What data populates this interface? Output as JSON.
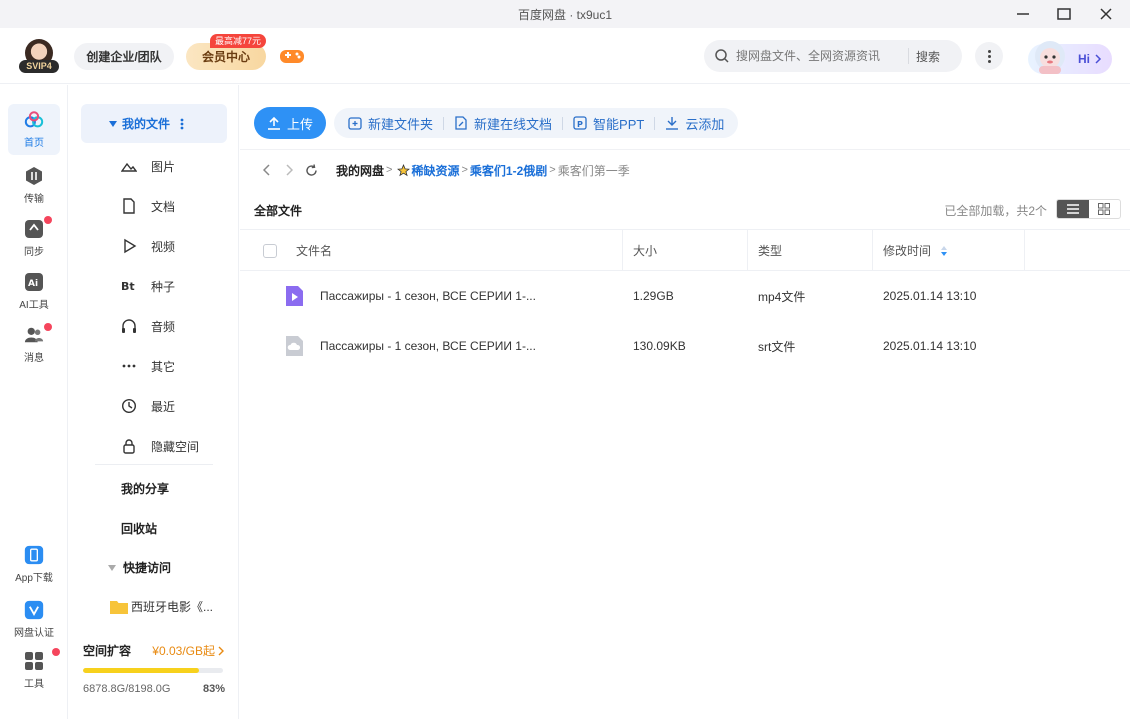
{
  "window": {
    "title": "百度网盘 · tx9uc1"
  },
  "header": {
    "vip_level": "SVIP4",
    "create_team": "创建企业/团队",
    "vip_center": "会员中心",
    "vip_badge": "最高减77元",
    "search_placeholder": "搜网盘文件、全网资源资讯",
    "search_button": "搜索",
    "hi": "Hi"
  },
  "rail": {
    "items": [
      {
        "label": "首页",
        "icon": "home-icon"
      },
      {
        "label": "传输",
        "icon": "transfer-icon"
      },
      {
        "label": "同步",
        "icon": "sync-icon"
      },
      {
        "label": "AI工具",
        "icon": "ai-icon"
      },
      {
        "label": "消息",
        "icon": "message-icon"
      }
    ],
    "bottom": [
      {
        "label": "App下载",
        "icon": "phone-icon"
      },
      {
        "label": "网盘认证",
        "icon": "verify-icon"
      },
      {
        "label": "工具",
        "icon": "grid-icon"
      }
    ]
  },
  "sidenav": {
    "my_files": "我的文件",
    "items": [
      "图片",
      "文档",
      "视频",
      "种子",
      "音频",
      "其它",
      "最近",
      "隐藏空间"
    ],
    "my_share": "我的分享",
    "recycle": "回收站",
    "quick_access": "快捷访问",
    "quick_folder": "西班牙电影《...",
    "storage": {
      "title": "空间扩容",
      "promo": "¥0.03/GB起",
      "used": "6878.8G/8198.0G",
      "percent": "83%",
      "fill": 0.83
    }
  },
  "toolbar": {
    "upload": "上传",
    "new_folder": "新建文件夹",
    "new_doc": "新建在线文档",
    "smart_ppt": "智能PPT",
    "cloud_add": "云添加"
  },
  "breadcrumb": {
    "root": "我的网盘",
    "c1": "稀缺资源",
    "c2": "乘客们1-2俄剧",
    "c3": "乘客们第一季"
  },
  "list": {
    "title": "全部文件",
    "status": "已全部加载，共2个",
    "columns": {
      "name": "文件名",
      "size": "大小",
      "type": "类型",
      "modified": "修改时间"
    },
    "rows": [
      {
        "name": "Пассажиры - 1 сезон, ВСЕ СЕРИИ 1-...",
        "size": "1.29GB",
        "type": "mp4文件",
        "modified": "2025.01.14 13:10",
        "icon": "video-file-icon"
      },
      {
        "name": "Пассажиры - 1 сезон, ВСЕ СЕРИИ 1-...",
        "size": "130.09KB",
        "type": "srt文件",
        "modified": "2025.01.14 13:10",
        "icon": "cloud-file-icon"
      }
    ]
  }
}
